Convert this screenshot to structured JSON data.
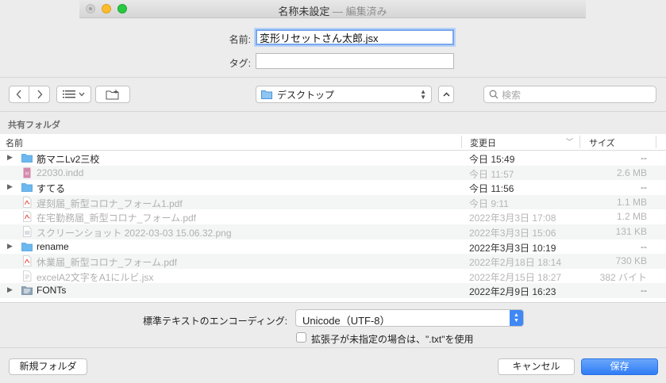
{
  "window": {
    "title": "名称未設定",
    "edited_suffix": "— 編集済み"
  },
  "form": {
    "name_label": "名前:",
    "name_value": "変形リセットさん太郎.jsx",
    "tag_label": "タグ:",
    "tag_value": ""
  },
  "toolbar": {
    "location": "デスクトップ",
    "search_placeholder": "検索"
  },
  "sidebar_section": "共有フォルダ",
  "columns": {
    "name": "名前",
    "date": "変更日",
    "size": "サイズ"
  },
  "files": [
    {
      "name": "筋マニLv2三校",
      "date": "今日 15:49",
      "size": "--",
      "kind": "folder",
      "expandable": true,
      "enabled": true
    },
    {
      "name": "22030.indd",
      "date": "今日 11:57",
      "size": "2.6 MB",
      "kind": "indd",
      "expandable": false,
      "enabled": false
    },
    {
      "name": "すてる",
      "date": "今日 11:56",
      "size": "--",
      "kind": "folder",
      "expandable": true,
      "enabled": true
    },
    {
      "name": "遅刻届_新型コロナ_フォーム1.pdf",
      "date": "今日 9:11",
      "size": "1.1 MB",
      "kind": "pdf",
      "expandable": false,
      "enabled": false
    },
    {
      "name": "在宅勤務届_新型コロナ_フォーム.pdf",
      "date": "2022年3月3日 17:08",
      "size": "1.2 MB",
      "kind": "pdf",
      "expandable": false,
      "enabled": false
    },
    {
      "name": "スクリーンショット 2022-03-03 15.06.32.png",
      "date": "2022年3月3日 15:06",
      "size": "131 KB",
      "kind": "png",
      "expandable": false,
      "enabled": false
    },
    {
      "name": "rename",
      "date": "2022年3月3日 10:19",
      "size": "--",
      "kind": "folder",
      "expandable": true,
      "enabled": true
    },
    {
      "name": "休業届_新型コロナ_フォーム.pdf",
      "date": "2022年2月18日 18:14",
      "size": "730 KB",
      "kind": "pdf",
      "expandable": false,
      "enabled": false
    },
    {
      "name": "excelA2文字をA1にルビ.jsx",
      "date": "2022年2月15日 18:27",
      "size": "382 バイト",
      "kind": "jsx",
      "expandable": false,
      "enabled": false
    },
    {
      "name": "FONTs",
      "date": "2022年2月9日 16:23",
      "size": "--",
      "kind": "fonts",
      "expandable": true,
      "enabled": true
    }
  ],
  "encoding": {
    "label": "標準テキストのエンコーディング:",
    "value": "Unicode（UTF-8）",
    "checkbox_label": "拡張子が未指定の場合は、\".txt\"を使用",
    "checkbox_checked": false
  },
  "buttons": {
    "new_folder": "新規フォルダ",
    "cancel": "キャンセル",
    "save": "保存"
  },
  "colors": {
    "accent": "#3f88f5",
    "folder": "#6cb8ef",
    "pdf": "#e0453a"
  }
}
